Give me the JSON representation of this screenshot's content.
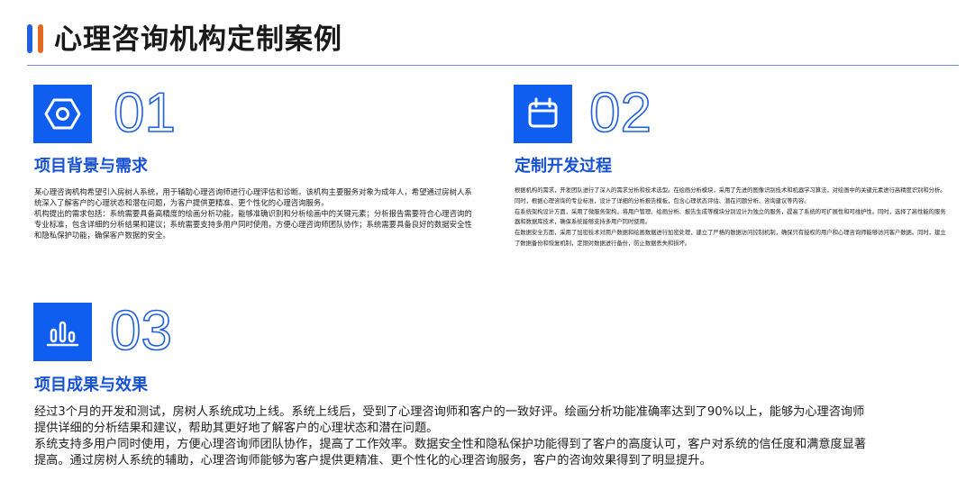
{
  "title": "心理咨询机构定制案例",
  "colors": {
    "primary": "#0f5ef0",
    "heading": "#1752d6",
    "accent_orange": "#e26a1e",
    "rule": "#6a8fe0"
  },
  "sections": [
    {
      "number": "01",
      "icon": "hexagon-nut-icon",
      "heading": "项目背景与需求",
      "paragraphs": [
        "某心理咨询机构希望引入房树人系统，用于辅助心理咨询师进行心理评估和诊断。该机构主要服务对象为成年人，希望通过房树人系统深入了解客户的心理状态和潜在问题，为客户提供更精准、更个性化的心理咨询服务。",
        "机构提出的需求包括：系统需要具备高精度的绘画分析功能，能够准确识别和分析绘画中的关键元素；分析报告需要符合心理咨询的专业标准，包含详细的分析结果和建议；系统需要支持多用户同时使用，方便心理咨询师团队协作；系统需要具备良好的数据安全性和隐私保护功能，确保客户数据的安全。"
      ]
    },
    {
      "number": "02",
      "icon": "calendar-icon",
      "heading": "定制开发过程",
      "paragraphs": [
        "根据机构的需求，开发团队进行了深入的需求分析和技术选型。在绘画分析模块，采用了先进的图像识别技术和机器学习算法，对绘画中的关键元素进行高精度识别和分析。同时，根据心理咨询的专业标准，设计了详细的分析报告模板，包含心理状态评估、潜在问题分析、咨询建议等内容。",
        "在系统架构设计方面，采用了微服务架构，将用户管理、绘画分析、报告生成等模块分别设计为独立的服务，提高了系统的可扩展性和可维护性。同时，选择了高性能的服务器和数据库技术，确保系统能够支持多用户同时使用。",
        "在数据安全方面，采用了加密技术对用户数据和绘画数据进行加密处理，建立了严格的数据访问控制机制，确保只有授权的用户和心理咨询师能够访问客户数据。同时，建立了数据备份和恢复机制，定期对数据进行备份，防止数据丢失和损坏。"
      ]
    },
    {
      "number": "03",
      "icon": "bar-chart-icon",
      "heading": "项目成果与效果",
      "paragraphs": [
        "经过3个月的开发和测试，房树人系统成功上线。系统上线后，受到了心理咨询师和客户的一致好评。绘画分析功能准确率达到了90%以上，能够为心理咨询师提供详细的分析结果和建议，帮助其更好地了解客户的心理状态和潜在问题。",
        "系统支持多用户同时使用，方便心理咨询师团队协作，提高了工作效率。数据安全性和隐私保护功能得到了客户的高度认可，客户对系统的信任度和满意度显著提高。通过房树人系统的辅助，心理咨询师能够为客户提供更精准、更个性化的心理咨询服务，客户的咨询效果得到了明显提升。"
      ]
    }
  ]
}
